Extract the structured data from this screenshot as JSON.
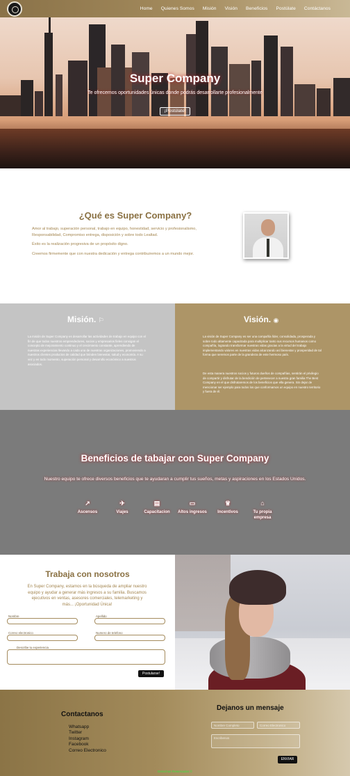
{
  "nav": {
    "links": [
      "Home",
      "Quienes Somos",
      "Misión",
      "Visión",
      "Beneficios",
      "Postúlate",
      "Contáctanos"
    ]
  },
  "hero": {
    "title": "Super Company",
    "subtitle": "Te ofrecemos oportunidades únicas donde podrás desarrollarte profesionalmente",
    "cta": "¡Postúlate!"
  },
  "about": {
    "title": "¿Qué es Super Company?",
    "paragraphs": [
      "Amor al trabajo, superación personal, trabajo en equipo, honestidad, servicio y profesionalismo, Responsabilidad, Compromiso entrega, disposición y sobre todo Lealtad.",
      "Éxito es la realización progresiva de un propósito digno.",
      "Creemos firmemente que con nuestra dedicación y entrega contribuiremos a un mundo mejor."
    ]
  },
  "mision": {
    "title": "Misión.",
    "text": "La misión de Super Company es desarrollar las actividades de trabajo en equipo con el fin de que todos nuestros emprendedores, socios y empresarios fieles consigan el concepto de mejoramiento continuo y el crecimiento constante, aprendiendo de nuestras experiencias llevando a cada una de nuestras organizaciones, promoviendo a nuestros clientes productos de calidad que brinden bienestar, salud y economía. A su vez y en todo momento, superación personal y desarrollo económico a nuestros asociados."
  },
  "vision": {
    "title": "Visión.",
    "text1": "La visión de Super Company es ser una compañía líder, consolidada, prosperada y sobre todo altamente capacitada para multiplicar tanto sus recursos humanos como compañía, logrando transformar nuestras vidas gracias a la virtud del trabajo implementando valores en nuestras vidas alcanzando así bienestar y prosperidad de tal forma que seremos parte de la grandeza de este hermoso país.",
    "text2": "De esta manera nuestros socios y futuros dueños de compañías, sentirán el privilegio de compartir y disfrutar de la bendición de pertenecer a nuestra gran familia The Best Company en el que disfrutaremos de los beneficios que ella genera. Sin dejar de mencionar ser ejemplo para todos los que conformamos un equipo en nuestro territorio y fuera de él."
  },
  "benefits": {
    "title": "Beneficios de tabajar con Super Company",
    "subtitle": "Nuestro equipo te ofrece diversos beneficios que te ayudaran a cumplir tus sueños, metas y aspiraciones en los Estados Unidos.",
    "items": [
      {
        "label": "Ascensos",
        "icon": "trending-up-icon"
      },
      {
        "label": "Viajes",
        "icon": "plane-icon"
      },
      {
        "label": "Capacitacion",
        "icon": "book-icon"
      },
      {
        "label": "Altos ingresos",
        "icon": "briefcase-icon"
      },
      {
        "label": "Incentivos",
        "icon": "trophy-icon"
      },
      {
        "label": "Tu propia empresa",
        "icon": "building-icon"
      }
    ]
  },
  "work": {
    "title": "Trabaja con nosotros",
    "text": "En Super Company, estamos en la búsqueda de ampliar nuestro equipo y ayudar a generar más ingresos a su familia. Buscamos ejecutivos en ventas, asesores comerciales, telemarketing y más... ¡Oportunidad Única!",
    "fields": {
      "nombre": "Nombre",
      "apellido": "Apellido",
      "correo": "Correo electronico",
      "telefono": "Numero de telefono",
      "experiencia": "Describe tu experiencia"
    },
    "submit": "Postularse!"
  },
  "contact": {
    "title": "Contactanos",
    "links": [
      "Whatsapp",
      "Twitter",
      "Instagram",
      "Facebook",
      "Correo Electronico"
    ],
    "message_title": "Dejanos un mensaje",
    "placeholders": {
      "nombre": "Nombre Completo",
      "correo": "Correo Electronico",
      "mensaje": "Escribenos"
    },
    "send": "ENVIAR"
  },
  "footer": {
    "copyright": "Derechos Reservados ©"
  },
  "colors": {
    "gold": "#a58c5e",
    "brown_text": "#8a7143",
    "grey": "#7b7b7b",
    "light_grey": "#c4c4c4",
    "tan": "#ad9567",
    "red_glow": "#b5252a"
  }
}
